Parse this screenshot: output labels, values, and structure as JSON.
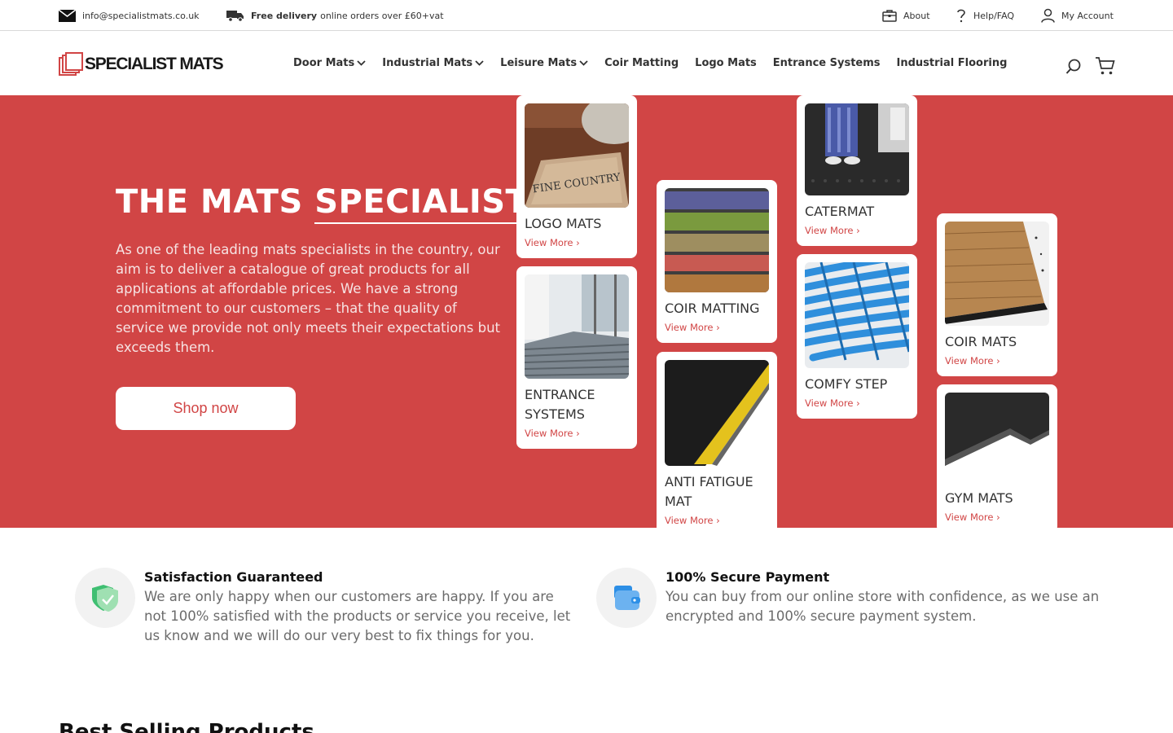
{
  "topbar": {
    "email": "info@specialistmats.co.uk",
    "delivery_bold": "Free delivery",
    "delivery_rest": "online orders over £60+vat",
    "about": "About",
    "help": "Help/FAQ",
    "account": "My Account"
  },
  "header": {
    "logo_text": "SPECIALIST MATS",
    "nav": [
      {
        "label": "Door Mats",
        "dropdown": true
      },
      {
        "label": "Industrial Mats",
        "dropdown": true
      },
      {
        "label": "Leisure Mats",
        "dropdown": true
      },
      {
        "label": "Coir Matting",
        "dropdown": false
      },
      {
        "label": "Logo Mats",
        "dropdown": false
      },
      {
        "label": "Entrance Systems",
        "dropdown": false
      },
      {
        "label": "Industrial Flooring",
        "dropdown": false
      }
    ]
  },
  "hero": {
    "title_part1": "THE MATS",
    "title_part2": "SPECIALIST",
    "description": "As one of the leading mats specialists in the country, our aim is to deliver a catalogue of great products for all applications at affordable prices. We have a strong commitment to our customers – that the quality of service we provide not only meets their expectations but exceeds them.",
    "button": "Shop now",
    "cards": [
      {
        "title": "LOGO MATS",
        "link": "View More ›",
        "image": "logo-mat-image"
      },
      {
        "title": "ENTRANCE SYSTEMS",
        "link": "View More ›",
        "image": "entrance-systems-image"
      },
      {
        "title": "COIR MATTING",
        "link": "View More ›",
        "image": "coir-matting-image"
      },
      {
        "title": "ANTI FATIGUE MAT",
        "link": "View More ›",
        "image": "anti-fatigue-image"
      },
      {
        "title": "CATERMAT",
        "link": "View More ›",
        "image": "catermat-image"
      },
      {
        "title": "COMFY STEP",
        "link": "View More ›",
        "image": "comfy-step-image"
      },
      {
        "title": "COIR MATS",
        "link": "View More ›",
        "image": "coir-mats-image"
      },
      {
        "title": "GYM MATS",
        "link": "View More ›",
        "image": "gym-mats-image"
      }
    ]
  },
  "features": [
    {
      "title": "Satisfaction Guaranteed",
      "description": "We are only happy when our customers are happy. If you are not 100% satisfied with the products or service you receive, let us know and we will do our very best to fix things for you.",
      "icon": "shield-check-icon"
    },
    {
      "title": "100% Secure Payment",
      "description": "You can buy from our online store with confidence, as we use an encrypted and 100% secure payment system.",
      "icon": "wallet-icon"
    }
  ],
  "best_selling": "Best Selling Products",
  "colors": {
    "brand_red": "#d14545"
  }
}
